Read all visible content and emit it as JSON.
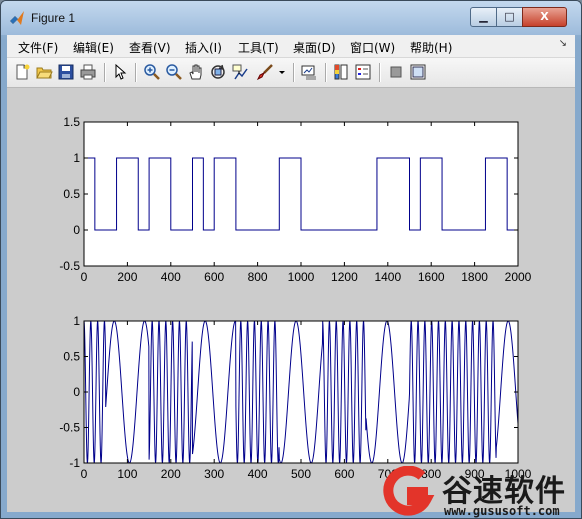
{
  "window": {
    "title": "Figure 1",
    "buttons": {
      "minimize": "▁",
      "maximize": "□",
      "close": "X"
    }
  },
  "menu": {
    "items": [
      "文件(F)",
      "编辑(E)",
      "查看(V)",
      "插入(I)",
      "工具(T)",
      "桌面(D)",
      "窗口(W)",
      "帮助(H)"
    ],
    "overflow_arrow": "↘"
  },
  "toolbar": {
    "icons": [
      "new-figure-icon",
      "open-file-icon",
      "save-icon",
      "print-icon",
      "edit-plot-arrow-icon",
      "zoom-in-icon",
      "zoom-out-icon",
      "pan-hand-icon",
      "rotate-3d-icon",
      "data-cursor-icon",
      "brush-icon",
      "brush-dropdown-icon",
      "link-plot-icon",
      "insert-colorbar-icon",
      "insert-legend-icon",
      "hide-plot-tools-icon",
      "show-plot-tools-icon"
    ]
  },
  "colors": {
    "line": "#00008b",
    "axes_bg": "#ffffff",
    "figure_bg": "#cccccc"
  },
  "chart_data": [
    {
      "type": "line",
      "title": "",
      "xlabel": "",
      "ylabel": "",
      "xlim": [
        0,
        2000
      ],
      "ylim": [
        -0.5,
        1.5
      ],
      "xticks": [
        "0",
        "200",
        "400",
        "600",
        "800",
        "1000",
        "1200",
        "1400",
        "1600",
        "1800",
        "2000"
      ],
      "yticks": [
        "-0.5",
        "0",
        "0.5",
        "1",
        "1.5"
      ],
      "series": [
        {
          "x": [
            0,
            50,
            50,
            150,
            150,
            250,
            250,
            300,
            300,
            400,
            400,
            500,
            500,
            550,
            550,
            600,
            600,
            700,
            700,
            900,
            900,
            1000,
            1000,
            1350,
            1350,
            1500,
            1500,
            1550,
            1550,
            1650,
            1650,
            1850,
            1850,
            1950,
            1950,
            2000
          ],
          "y": [
            1,
            1,
            0,
            0,
            1,
            1,
            0,
            0,
            1,
            1,
            0,
            0,
            1,
            1,
            0,
            0,
            1,
            1,
            0,
            0,
            1,
            1,
            0,
            0,
            1,
            1,
            0,
            0,
            1,
            1,
            0,
            0,
            1,
            1,
            0,
            0
          ]
        }
      ]
    },
    {
      "type": "line",
      "title": "",
      "xlabel": "",
      "ylabel": "",
      "xlim": [
        0,
        1000
      ],
      "ylim": [
        -1,
        1
      ],
      "xticks": [
        "0",
        "100",
        "200",
        "300",
        "400",
        "500",
        "600",
        "700",
        "800",
        "900",
        "1000"
      ],
      "yticks": [
        "-1",
        "-0.5",
        "0",
        "0.5",
        "1"
      ],
      "bit_duration": 50,
      "bits": [
        1,
        0,
        0,
        1,
        1,
        0,
        0,
        1,
        1,
        0,
        0,
        1,
        1,
        0,
        0,
        1,
        1,
        1,
        1,
        0,
        0,
        0,
        0,
        0,
        0,
        0,
        0,
        1,
        1,
        1,
        0,
        1,
        1,
        0,
        0,
        0,
        0,
        1,
        1,
        0
      ],
      "freq_bit_1": 0.4,
      "freq_bit_0": 0.09
    }
  ],
  "watermark": {
    "brand": "谷速软件",
    "url": "www.gususoft.com"
  }
}
